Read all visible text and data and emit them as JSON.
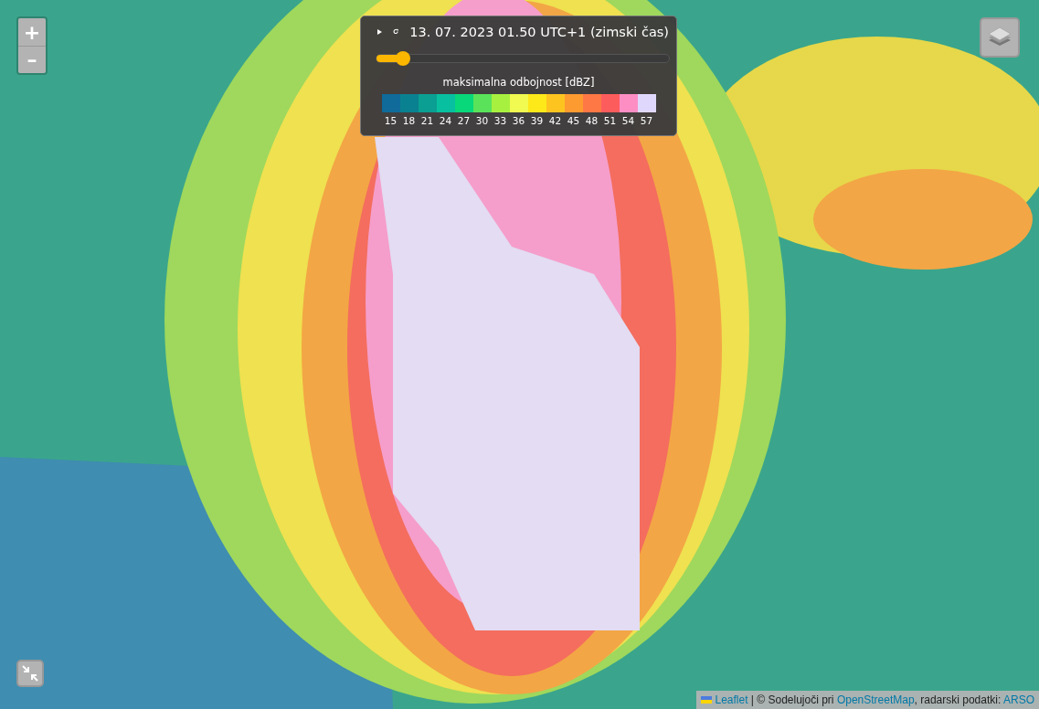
{
  "zoom": {
    "in": "+",
    "out": "–"
  },
  "panel": {
    "timestamp": "13. 07. 2023 01.50 UTC+1 (zimski čas)",
    "slider": {
      "level": 0.09
    },
    "legend_title": "maksimalna odbojnost [dBZ]",
    "legend": [
      {
        "label": "15",
        "color": "#106b9a"
      },
      {
        "label": "18",
        "color": "#0a8190"
      },
      {
        "label": "21",
        "color": "#0a9f92"
      },
      {
        "label": "24",
        "color": "#08c0a0"
      },
      {
        "label": "27",
        "color": "#08d87a"
      },
      {
        "label": "30",
        "color": "#5ae35a"
      },
      {
        "label": "33",
        "color": "#a8f040"
      },
      {
        "label": "36",
        "color": "#f0fa50"
      },
      {
        "label": "39",
        "color": "#fde81a"
      },
      {
        "label": "42",
        "color": "#fdc420"
      },
      {
        "label": "45",
        "color": "#fd9a30"
      },
      {
        "label": "48",
        "color": "#fd7845"
      },
      {
        "label": "51",
        "color": "#fd5c5c"
      },
      {
        "label": "54",
        "color": "#fd8ec4"
      },
      {
        "label": "57",
        "color": "#e0d8fc"
      }
    ]
  },
  "attribution": [
    {
      "kind": "link",
      "text": "Leaflet"
    },
    {
      "kind": "text",
      "text": " | © Sodelujoči pri "
    },
    {
      "kind": "link",
      "text": "OpenStreetMap"
    },
    {
      "kind": "text",
      "text": ", radarski podatki: "
    },
    {
      "kind": "link",
      "text": "ARSO"
    }
  ]
}
